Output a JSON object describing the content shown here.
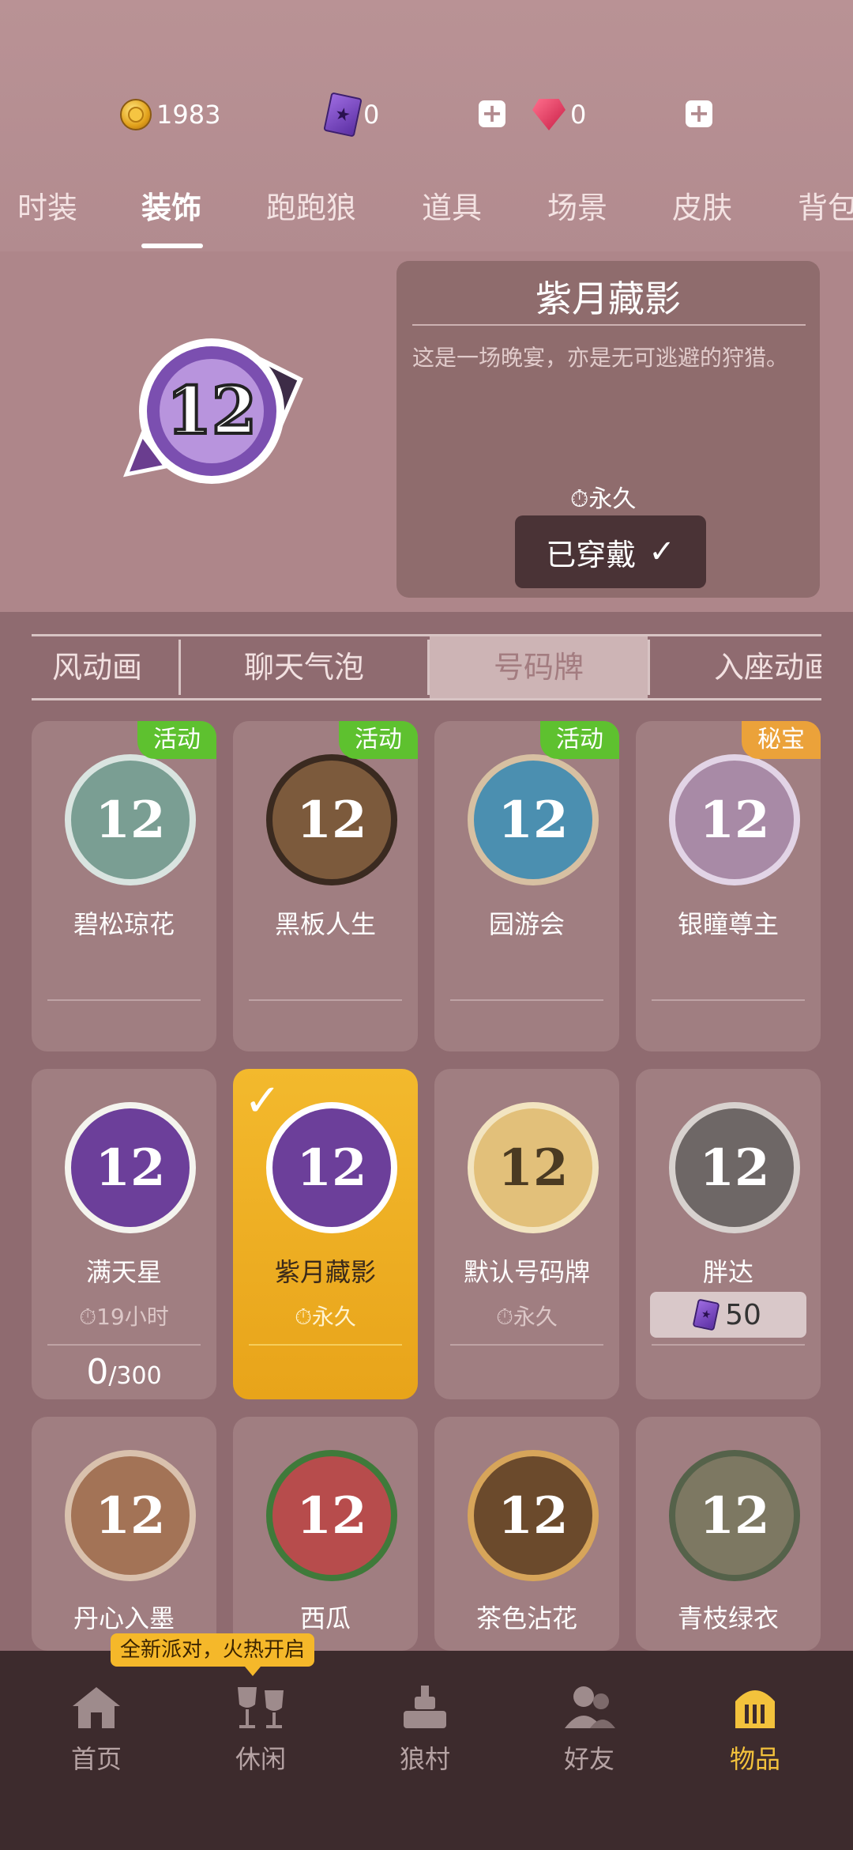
{
  "currencies": {
    "coins": "1983",
    "tickets": "0",
    "gems": "0"
  },
  "tabs": [
    "时装",
    "装饰",
    "跑跑狼",
    "道具",
    "场景",
    "皮肤",
    "背包"
  ],
  "preview": {
    "title": "紫月藏影",
    "description": "这是一场晚宴，亦是无可逃避的狩猎。",
    "duration": "永久",
    "wear_button": "已穿戴"
  },
  "subtabs": [
    "风动画",
    "聊天气泡",
    "号码牌",
    "入座动画"
  ],
  "items": [
    {
      "name": "碧松琼花",
      "tag": "活动",
      "tag_color": "#5ec12f",
      "badge_color": "#7a9e93"
    },
    {
      "name": "黑板人生",
      "tag": "活动",
      "tag_color": "#5ec12f",
      "badge_color": "#7c5a3c"
    },
    {
      "name": "园游会",
      "tag": "活动",
      "tag_color": "#5ec12f",
      "badge_color": "#4b8fb0"
    },
    {
      "name": "银瞳尊主",
      "tag": "秘宝",
      "tag_color": "#eba23a",
      "badge_color": "#a88aa6"
    },
    {
      "name": "满天星",
      "time": "19小时",
      "progress": "0",
      "progress_total": "/300",
      "badge_color": "#6c3f9a"
    },
    {
      "name": "紫月藏影",
      "time": "永久",
      "badge_color": "#6c3f9a"
    },
    {
      "name": "默认号码牌",
      "time": "永久",
      "badge_color": "#e2c07a"
    },
    {
      "name": "胖达",
      "price": "50",
      "badge_color": "#6e6766"
    },
    {
      "name": "丹心入墨",
      "badge_color": "#a37356"
    },
    {
      "name": "西瓜",
      "badge_color": "#b74c4c"
    },
    {
      "name": "茶色沾花",
      "badge_color": "#6b4a2c"
    },
    {
      "name": "青枝绿衣",
      "badge_color": "#7d7862"
    }
  ],
  "promo": "全新派对，火热开启",
  "nav": [
    {
      "label": "首页"
    },
    {
      "label": "休闲"
    },
    {
      "label": "狼村"
    },
    {
      "label": "好友"
    },
    {
      "label": "物品"
    }
  ]
}
